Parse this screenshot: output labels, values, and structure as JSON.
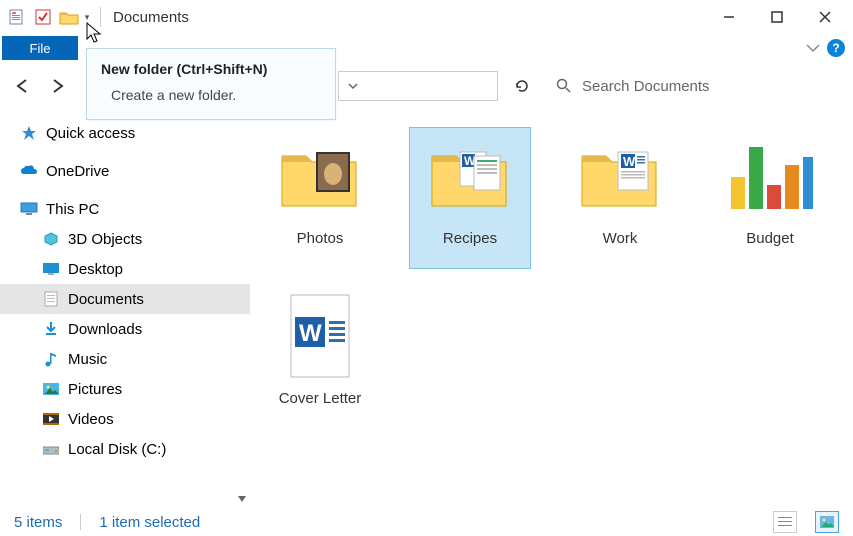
{
  "titlebar": {
    "title": "Documents"
  },
  "ribbon": {
    "file_label": "File",
    "help_label": "?"
  },
  "tooltip": {
    "title": "New folder (Ctrl+Shift+N)",
    "body": "Create a new folder."
  },
  "search": {
    "placeholder": "Search Documents"
  },
  "sidebar": {
    "quick_access": "Quick access",
    "onedrive": "OneDrive",
    "this_pc": "This PC",
    "items": [
      "3D Objects",
      "Desktop",
      "Documents",
      "Downloads",
      "Music",
      "Pictures",
      "Videos",
      "Local Disk (C:)"
    ]
  },
  "content": {
    "items": [
      {
        "label": "Photos"
      },
      {
        "label": "Recipes"
      },
      {
        "label": "Work"
      },
      {
        "label": "Budget"
      },
      {
        "label": "Cover Letter"
      }
    ]
  },
  "statusbar": {
    "count": "5 items",
    "selected": "1 item selected"
  }
}
